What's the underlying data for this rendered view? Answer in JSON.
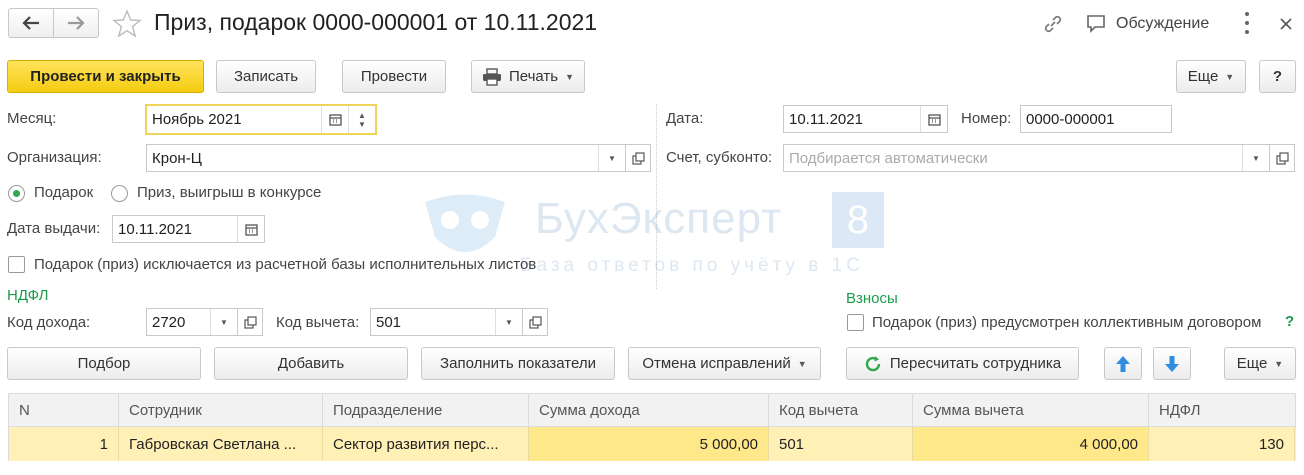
{
  "window": {
    "title": "Приз, подарок 0000-000001 от 10.11.2021",
    "discuss_label": "Обсуждение"
  },
  "toolbar": {
    "post_close": "Провести и закрыть",
    "save": "Записать",
    "post": "Провести",
    "print": "Печать",
    "more": "Еще",
    "help": "?"
  },
  "form": {
    "month_label": "Месяц:",
    "month_value": "Ноябрь 2021",
    "date_label": "Дата:",
    "date_value": "10.11.2021",
    "number_label": "Номер:",
    "number_value": "0000-000001",
    "org_label": "Организация:",
    "org_value": "Крон-Ц",
    "account_label": "Счет, субконто:",
    "account_placeholder": "Подбирается автоматически",
    "radio_gift": "Подарок",
    "radio_prize": "Приз, выигрыш в конкурсе",
    "issue_date_label": "Дата выдачи:",
    "issue_date_value": "10.11.2021",
    "exclude_check": "Подарок (приз) исключается из расчетной базы исполнительных листов",
    "ndfl_section": "НДФЛ",
    "income_code_label": "Код дохода:",
    "income_code_value": "2720",
    "deduction_code_label": "Код вычета:",
    "deduction_code_value": "501",
    "contrib_section": "Взносы",
    "collective_check": "Подарок (приз) предусмотрен коллективным договором",
    "question": "?"
  },
  "table_toolbar": {
    "pick": "Подбор",
    "add": "Добавить",
    "fill": "Заполнить показатели",
    "cancel_fix": "Отмена исправлений",
    "recalc": "Пересчитать сотрудника",
    "more": "Еще"
  },
  "table": {
    "headers": [
      "N",
      "Сотрудник",
      "Подразделение",
      "Сумма дохода",
      "Код вычета",
      "Сумма вычета",
      "НДФЛ"
    ],
    "rows": [
      [
        "1",
        "Габровская Светлана ...",
        "Сектор развития перс...",
        "5 000,00",
        "501",
        "4 000,00",
        "130"
      ]
    ]
  },
  "watermark": {
    "brand": "БухЭксперт",
    "digit": "8",
    "tagline": "База ответов по учёту в 1С"
  },
  "colors": {
    "primary_button": "#f5cc10",
    "section_green": "#1a9c4b",
    "row_highlight": "#fff1b5",
    "arrow_blue": "#2f8ee0"
  },
  "icons": [
    "back-arrow-icon",
    "forward-arrow-icon",
    "star-icon",
    "link-icon",
    "discussion-icon",
    "more-vertical-icon",
    "close-icon",
    "printer-icon",
    "calendar-icon",
    "spin-icon",
    "dropdown-icon",
    "open-icon",
    "refresh-icon",
    "arrow-up-icon",
    "arrow-down-icon"
  ]
}
